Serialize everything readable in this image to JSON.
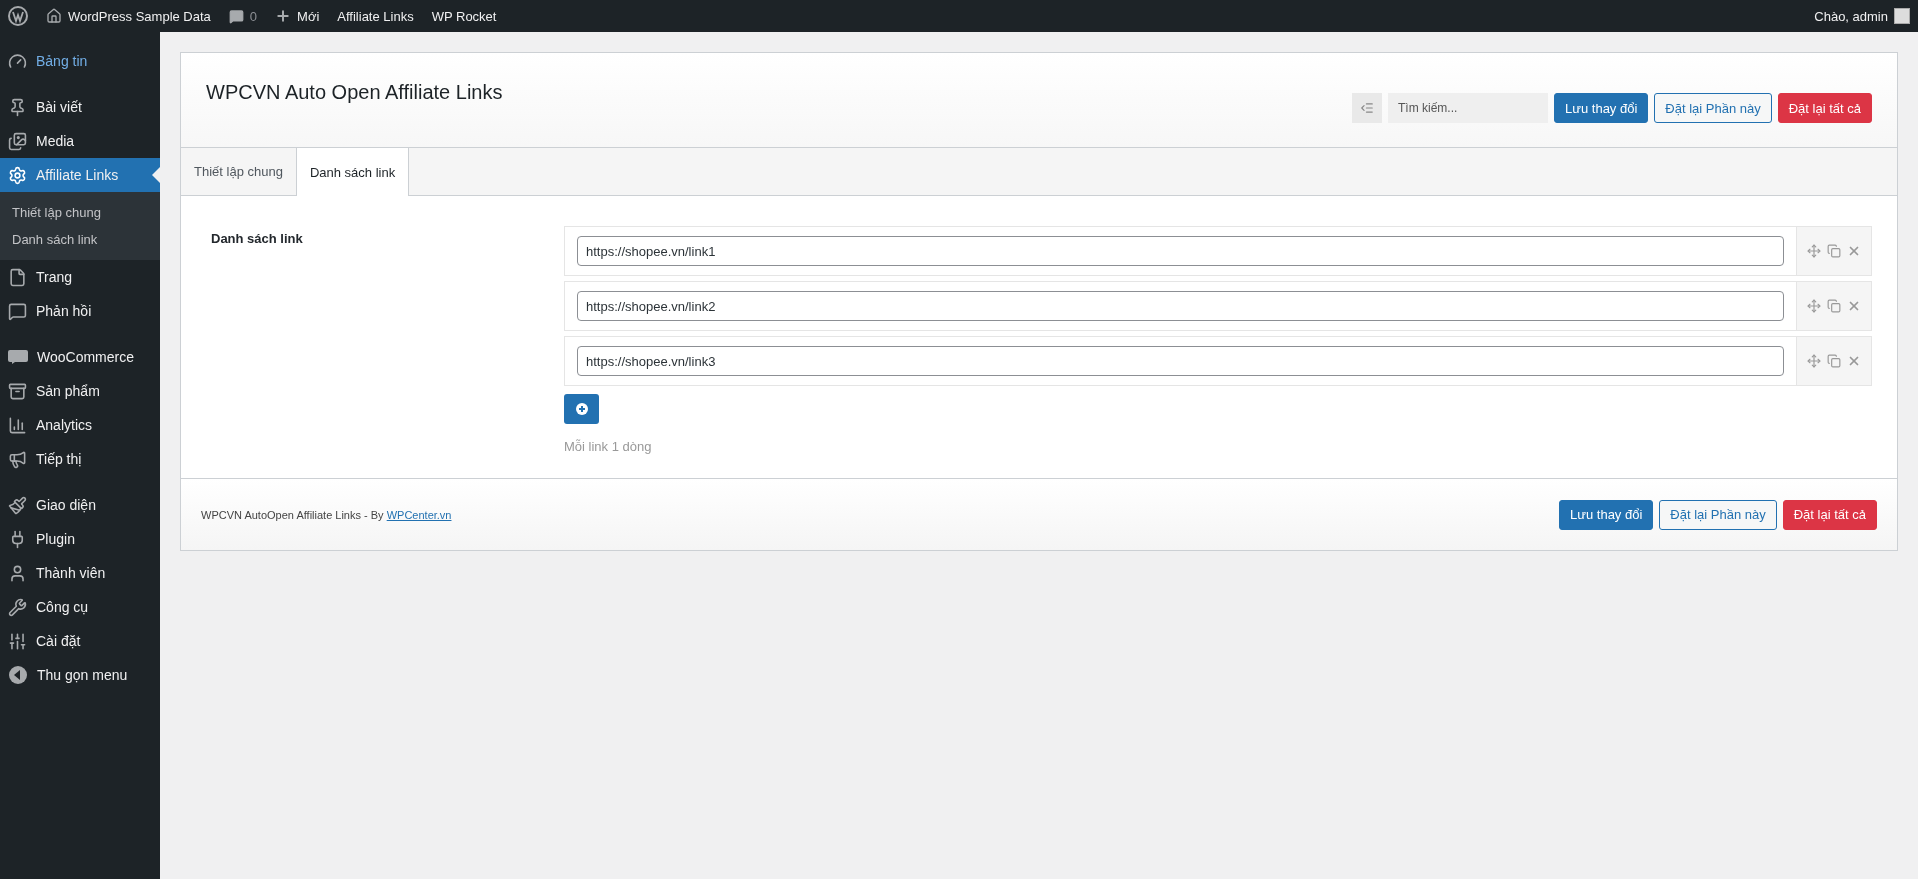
{
  "admin_bar": {
    "site": "WordPress Sample Data",
    "comments": "0",
    "new": "Mới",
    "links": [
      "Affiliate Links",
      "WP Rocket"
    ],
    "greeting": "Chào, admin"
  },
  "sidebar": {
    "groups": [
      [
        {
          "label": "Bảng tin",
          "selected": false,
          "hovered": true
        }
      ],
      [
        {
          "label": "Bài viết",
          "selected": false,
          "hovered": false
        },
        {
          "label": "Media",
          "selected": false,
          "hovered": false
        },
        {
          "label": "Affiliate Links",
          "selected": true,
          "hovered": false,
          "children": [
            {
              "label": "Thiết lập chung"
            },
            {
              "label": "Danh sách link"
            }
          ]
        },
        {
          "label": "Trang",
          "selected": false,
          "hovered": false
        },
        {
          "label": "Phản hồi",
          "selected": false,
          "hovered": false
        }
      ],
      [
        {
          "label": "WooCommerce",
          "selected": false,
          "hovered": false
        },
        {
          "label": "Sản phẩm",
          "selected": false,
          "hovered": false
        },
        {
          "label": "Analytics",
          "selected": false,
          "hovered": false
        },
        {
          "label": "Tiếp thị",
          "selected": false,
          "hovered": false
        }
      ],
      [
        {
          "label": "Giao diện",
          "selected": false,
          "hovered": false
        },
        {
          "label": "Plugin",
          "selected": false,
          "hovered": false
        },
        {
          "label": "Thành viên",
          "selected": false,
          "hovered": false
        },
        {
          "label": "Công cụ",
          "selected": false,
          "hovered": false
        },
        {
          "label": "Cài đặt",
          "selected": false,
          "hovered": false
        },
        {
          "label": "Thu gọn menu",
          "selected": false,
          "hovered": false
        }
      ]
    ]
  },
  "panel": {
    "title": "WPCVN Auto Open Affiliate Links",
    "search": {
      "placeholder": "Tìm kiếm..."
    },
    "header_buttons": [
      {
        "label": "Lưu thay đổi",
        "kind": "primary"
      },
      {
        "label": "Đặt lại Phần này",
        "kind": "secondary"
      },
      {
        "label": "Đặt lại tất cả",
        "kind": "danger"
      }
    ],
    "tabs": [
      {
        "label": "Thiết lập chung",
        "selected": false
      },
      {
        "label": "Danh sách link",
        "selected": true
      }
    ],
    "field_label": "Danh sách link",
    "links": [
      "https://shopee.vn/link1",
      "https://shopee.vn/link2",
      "https://shopee.vn/link3"
    ],
    "hint": "Mỗi link 1 dòng",
    "footer": {
      "text": "WPCVN AutoOpen Affiliate Links - By ",
      "link": "WPCenter.vn"
    },
    "footer_buttons": [
      {
        "label": "Lưu thay đổi",
        "kind": "primary"
      },
      {
        "label": "Đặt lại Phần này",
        "kind": "secondary"
      },
      {
        "label": "Đặt lại tất cả",
        "kind": "danger"
      }
    ]
  }
}
